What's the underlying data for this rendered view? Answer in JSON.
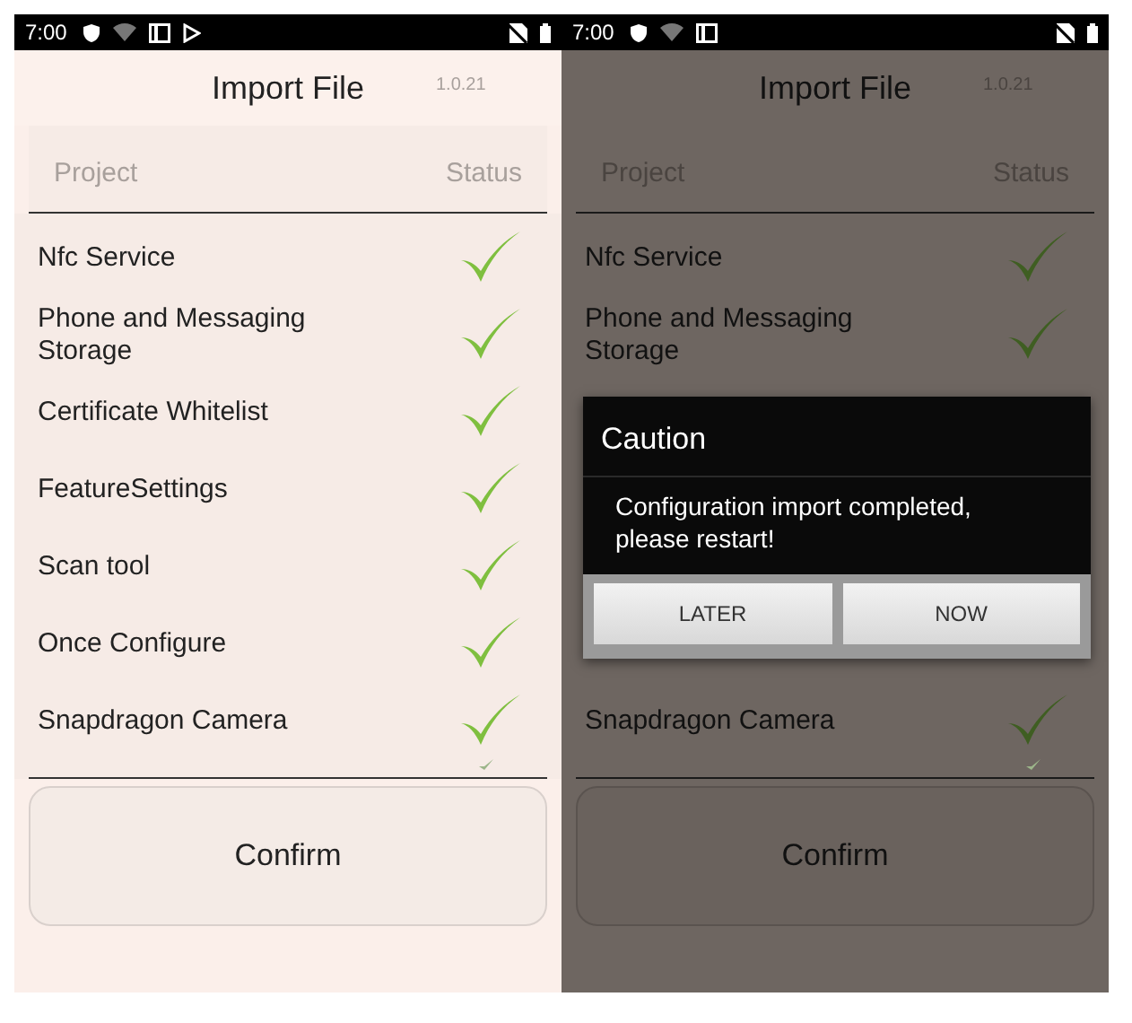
{
  "screens": [
    {
      "status_bar": {
        "time": "7:00",
        "casting": true
      },
      "title": "Import File",
      "version": "1.0.21",
      "columns": [
        "Project",
        "Status"
      ],
      "rows": [
        {
          "name": "Nfc Service",
          "checked": true
        },
        {
          "name": "Phone and Messaging Storage",
          "checked": true
        },
        {
          "name": "Certificate Whitelist",
          "checked": true
        },
        {
          "name": "FeatureSettings",
          "checked": true
        },
        {
          "name": "Scan tool",
          "checked": true
        },
        {
          "name": "Once Configure",
          "checked": true
        },
        {
          "name": "Snapdragon Camera",
          "checked": true
        }
      ],
      "button": "Confirm"
    },
    {
      "status_bar": {
        "time": "7:00",
        "casting": false
      },
      "title": "Import File",
      "version": "1.0.21",
      "columns": [
        "Project",
        "Status"
      ],
      "rows": [
        {
          "name": "Nfc Service",
          "checked": true
        },
        {
          "name": "Phone and Messaging Storage",
          "checked": true
        }
      ],
      "dialog": {
        "title": "Caution",
        "message": "Configuration import completed, please restart!",
        "buttons": [
          "LATER",
          "NOW"
        ]
      },
      "rows_below": [
        {
          "name": "Snapdragon Camera",
          "checked": true
        }
      ],
      "button": "Confirm"
    }
  ]
}
